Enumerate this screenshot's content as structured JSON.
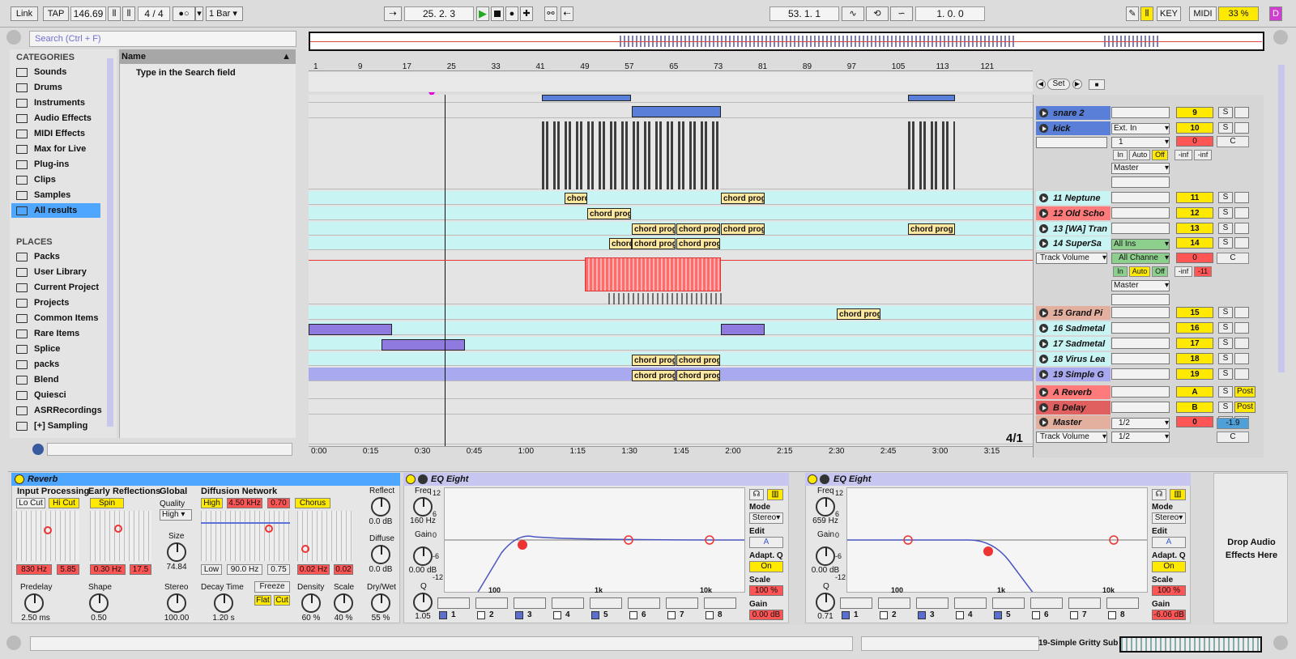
{
  "transport": {
    "link": "Link",
    "tap": "TAP",
    "tempo": "146.69",
    "time_sig": "4 / 4",
    "quantize": "1 Bar",
    "position": "25.  2.  3",
    "loop_start": "53.  1.  1",
    "loop_length": "1.  0.  0",
    "key": "KEY",
    "midi": "MIDI",
    "cpu": "33 %",
    "d": "D"
  },
  "browser": {
    "search_placeholder": "Search (Ctrl + F)",
    "categories_title": "CATEGORIES",
    "categories": [
      "Sounds",
      "Drums",
      "Instruments",
      "Audio Effects",
      "MIDI Effects",
      "Max for Live",
      "Plug-ins",
      "Clips",
      "Samples",
      "All results"
    ],
    "places_title": "PLACES",
    "places": [
      "Packs",
      "User Library",
      "Current Project",
      "Projects",
      "Common Items",
      "Rare Items",
      "Splice",
      "packs",
      "Blend",
      "Quiesci",
      "ASRRecordings",
      "[+] Sampling"
    ],
    "name_header": "Name",
    "hint": "Type in the Search field"
  },
  "ruler": {
    "bars": [
      "1",
      "9",
      "17",
      "25",
      "33",
      "41",
      "49",
      "57",
      "65",
      "73",
      "81",
      "89",
      "97",
      "105",
      "113",
      "121"
    ],
    "times": [
      "0:00",
      "0:15",
      "0:30",
      "0:45",
      "1:00",
      "1:15",
      "1:30",
      "1:45",
      "2:00",
      "2:15",
      "2:30",
      "2:45",
      "3:00",
      "3:15"
    ]
  },
  "clips": {
    "chord": "chord prog",
    "chord_short": "chord"
  },
  "tracks": [
    {
      "name": "snare 2",
      "num": "9"
    },
    {
      "name": "kick",
      "num": "10",
      "input": "Ext. In",
      "chan": "1",
      "vol": "0",
      "pan": "C",
      "in": "In",
      "auto": "Auto",
      "off": "Off",
      "inf1": "-inf",
      "inf2": "-inf",
      "out": "Master"
    },
    {
      "name": "11 Neptune",
      "num": "11"
    },
    {
      "name": "12 Old Scho",
      "num": "12"
    },
    {
      "name": "13 [WA] Tran",
      "num": "13"
    },
    {
      "name": "14 SuperSa",
      "num": "14",
      "input": "All Ins",
      "chan": "All Channe",
      "vol": "0",
      "pan": "C",
      "in": "In",
      "auto": "Auto",
      "off": "Off",
      "inf1": "-inf",
      "inf2": "-11",
      "out": "Master",
      "lane": "Track Volume"
    },
    {
      "name": "15 Grand Pi",
      "num": "15"
    },
    {
      "name": "16 Sadmetal",
      "num": "16"
    },
    {
      "name": "17 Sadmetal",
      "num": "17"
    },
    {
      "name": "18 Virus Lea",
      "num": "18"
    },
    {
      "name": "19 Simple G",
      "num": "19"
    },
    {
      "name": "A Reverb",
      "num": "A",
      "post": "Post"
    },
    {
      "name": "B Delay",
      "num": "B",
      "post": "Post"
    },
    {
      "name": "Master",
      "num": "0",
      "out": "1/2",
      "vol": "-1.9",
      "pan": "C",
      "lane": "Track Volume"
    }
  ],
  "arrangement": {
    "set": "Set",
    "zoom": "4/1",
    "solo": "S"
  },
  "reverb": {
    "title": "Reverb",
    "input_processing": "Input Processing",
    "lo_cut": "Lo Cut",
    "hi_cut": "Hi Cut",
    "early": "Early Reflections",
    "spin": "Spin",
    "global": "Global",
    "quality_lbl": "Quality",
    "quality": "High",
    "size_lbl": "Size",
    "size": "74.84",
    "diffusion": "Diffusion Network",
    "high": "High",
    "freq_high": "4.50 kHz",
    "high_val": "0.70",
    "chorus": "Chorus",
    "reflect_lbl": "Reflect",
    "reflect": "0.0 dB",
    "diffuse_lbl": "Diffuse",
    "diffuse": "0.0 dB",
    "in_freq": "830 Hz",
    "in_q": "5.85",
    "er_freq": "0.30 Hz",
    "er_amt": "17.5",
    "low": "Low",
    "low_freq": "90.0 Hz",
    "low_val": "0.75",
    "ch_rate": "0.02 Hz",
    "ch_amt": "0.02",
    "predelay_lbl": "Predelay",
    "predelay": "2.50 ms",
    "shape_lbl": "Shape",
    "shape": "0.50",
    "stereo_lbl": "Stereo",
    "stereo": "100.00",
    "decay_lbl": "Decay Time",
    "decay": "1.20 s",
    "freeze": "Freeze",
    "flat": "Flat",
    "cut": "Cut",
    "density_lbl": "Density",
    "density": "60 %",
    "scale_lbl": "Scale",
    "scale": "40 %",
    "drywet_lbl": "Dry/Wet",
    "drywet": "55 %"
  },
  "eq1": {
    "title": "EQ Eight",
    "freq_lbl": "Freq",
    "freq": "160 Hz",
    "gain_lbl": "Gain",
    "gain": "0.00 dB",
    "q_lbl": "Q",
    "q": "1.05",
    "mode_lbl": "Mode",
    "mode": "Stereo",
    "edit_lbl": "Edit",
    "edit": "A",
    "adapt_lbl": "Adapt. Q",
    "adapt": "On",
    "scale_lbl": "Scale",
    "scale": "100 %",
    "gain2_lbl": "Gain",
    "gain2": "0.00 dB",
    "yticks": [
      "12",
      "6",
      "0",
      "-6",
      "-12"
    ],
    "xticks": [
      "100",
      "1k",
      "10k"
    ],
    "bands": [
      "1",
      "2",
      "3",
      "4",
      "5",
      "6",
      "7",
      "8"
    ]
  },
  "eq2": {
    "title": "EQ Eight",
    "freq_lbl": "Freq",
    "freq": "659 Hz",
    "gain_lbl": "Gain",
    "gain": "0.00 dB",
    "q_lbl": "Q",
    "q": "0.71",
    "mode_lbl": "Mode",
    "mode": "Stereo",
    "edit_lbl": "Edit",
    "edit": "A",
    "adapt_lbl": "Adapt. Q",
    "adapt": "On",
    "scale_lbl": "Scale",
    "scale": "100 %",
    "gain2_lbl": "Gain",
    "gain2": "-6.06 dB",
    "yticks": [
      "12",
      "6",
      "0",
      "-6",
      "-12"
    ],
    "xticks": [
      "100",
      "1k",
      "10k"
    ],
    "bands": [
      "1",
      "2",
      "3",
      "4",
      "5",
      "6",
      "7",
      "8"
    ]
  },
  "drop_hint": "Drop Audio Effects Here",
  "status": {
    "track_name": "19-Simple Gritty Sub"
  },
  "colors": {
    "accent": "#ffe900",
    "track_blue": "#5a7fd8",
    "clip_cyan": "#c8f4f4",
    "purple": "#8f7adf",
    "red": "#ff5555",
    "selected": "#4fa6ff"
  }
}
